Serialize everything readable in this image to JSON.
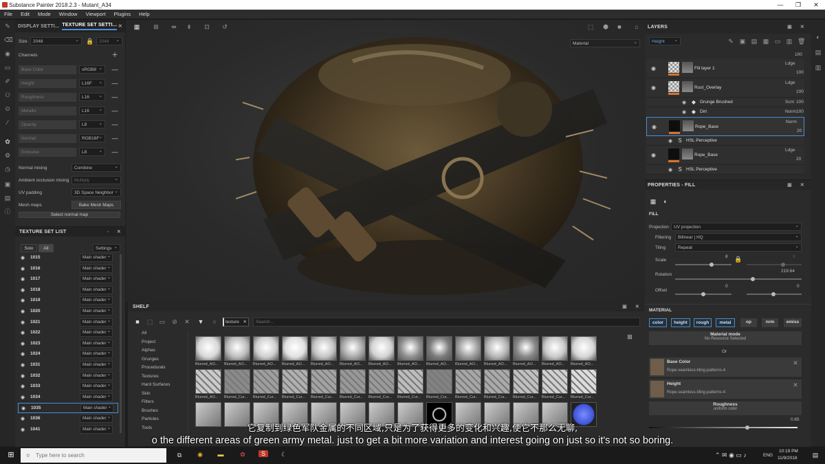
{
  "window": {
    "title": "Substance Painter 2018.2.3 - Mutant_A34",
    "controls": [
      "—",
      "❐",
      "✕"
    ]
  },
  "menu": [
    "File",
    "Edit",
    "Mode",
    "Window",
    "Viewport",
    "Plugins",
    "Help"
  ],
  "left_panel": {
    "tabs": [
      "DISPLAY SETTI...",
      "TEXTURE SET SETTI..."
    ],
    "size_label": "Size",
    "size_value": "2048",
    "size_value2": "2048",
    "channels_label": "Channels",
    "channels": [
      {
        "name": "Base Color",
        "format": "sRGB8"
      },
      {
        "name": "Height",
        "format": "L16F"
      },
      {
        "name": "Roughness",
        "format": "L16"
      },
      {
        "name": "Metallic",
        "format": "L16"
      },
      {
        "name": "Opacity",
        "format": "L8"
      },
      {
        "name": "Normal",
        "format": "RGB16F"
      },
      {
        "name": "Emissive",
        "format": "L8"
      }
    ],
    "normal_mixing_label": "Normal mixing",
    "normal_mixing_value": "Combine",
    "ao_mixing_label": "Ambient occlusion mixing",
    "ao_mixing_value": "Multiply",
    "uv_padding_label": "UV padding",
    "uv_padding_value": "3D Space Neighbor",
    "mesh_maps_label": "Mesh maps",
    "bake_button": "Bake Mesh Maps",
    "select_normal_button": "Select normal map"
  },
  "texture_set_list": {
    "title": "TEXTURE SET LIST",
    "solo": "Solo",
    "all": "All",
    "settings": "Settings",
    "items": [
      {
        "id": "1015",
        "shader": "Main shader"
      },
      {
        "id": "1016",
        "shader": "Main shader"
      },
      {
        "id": "1017",
        "shader": "Main shader"
      },
      {
        "id": "1018",
        "shader": "Main shader"
      },
      {
        "id": "1019",
        "shader": "Main shader"
      },
      {
        "id": "1020",
        "shader": "Main shader"
      },
      {
        "id": "1021",
        "shader": "Main shader"
      },
      {
        "id": "1022",
        "shader": "Main shader"
      },
      {
        "id": "1023",
        "shader": "Main shader"
      },
      {
        "id": "1024",
        "shader": "Main shader"
      },
      {
        "id": "1031",
        "shader": "Main shader"
      },
      {
        "id": "1032",
        "shader": "Main shader"
      },
      {
        "id": "1033",
        "shader": "Main shader"
      },
      {
        "id": "1034",
        "shader": "Main shader"
      },
      {
        "id": "1035",
        "shader": "Main shader"
      },
      {
        "id": "1036",
        "shader": "Main shader"
      },
      {
        "id": "1041",
        "shader": "Main shader"
      }
    ],
    "selected": "1035"
  },
  "viewport": {
    "mode": "Material"
  },
  "shelf": {
    "title": "SHELF",
    "filter": "texture",
    "search_placeholder": "Search...",
    "categories": [
      "All",
      "Project",
      "Alphas",
      "Grunges",
      "Procedurals",
      "Textures",
      "Hard Surfaces",
      "Skin",
      "Filters",
      "Brushes",
      "Particles",
      "Tools"
    ],
    "row1_labels": [
      "Blurred_AO...",
      "Blurred_AO...",
      "Blurred_AO...",
      "Blurred_AO...",
      "Blurred_AO...",
      "Blurred_AO...",
      "Blurred_AO...",
      "Blurred_AO...",
      "Blurred_AO...",
      "Blurred_AO...",
      "Blurred_AO...",
      "Blurred_AO...",
      "Blurred_AO...",
      "Blurred_AO..."
    ],
    "row2_labels": [
      "Blurred_AO...",
      "Blurred_Cur...",
      "Blurred_Cur...",
      "Blurred_Cur...",
      "Blurred_Cur...",
      "Blurred_Cur...",
      "Blurred_Cur...",
      "Blurred_Cur...",
      "Blurred_Cur...",
      "Blurred_Cur...",
      "Blurred_Cur...",
      "Blurred_Cur...",
      "Blurred_Cur...",
      "Blurred_Cur..."
    ]
  },
  "layers": {
    "title": "LAYERS",
    "channel": "Height",
    "items": [
      {
        "name": "Fill layer 1",
        "blend": "Ldge",
        "opacity": "100"
      },
      {
        "name": "Rust_Overlay",
        "blend": "Ldge",
        "opacity": "100"
      },
      {
        "name": "Grunge Brushed",
        "blend": "Scrn",
        "opacity": "100"
      },
      {
        "name": "Dirt",
        "blend": "Norm",
        "opacity": "100"
      },
      {
        "name": "Rope_Base",
        "blend": "Norm",
        "opacity": "20"
      },
      {
        "name": "HSL Perceptive",
        "blend": "",
        "opacity": ""
      },
      {
        "name": "Rope_Base",
        "blend": "Ldge",
        "opacity": "20"
      },
      {
        "name": "HSL Perceptive",
        "blend": "",
        "opacity": ""
      }
    ],
    "top_opacity": "100"
  },
  "properties": {
    "title": "PROPERTIES - FILL",
    "fill_label": "FILL",
    "projection_label": "Projection",
    "projection_value": "UV projection",
    "filtering_label": "Filtering",
    "filtering_value": "Bilinear | HQ",
    "tiling_label": "Tiling",
    "tiling_value": "Repeat",
    "scale_label": "Scale",
    "scale_value": "8",
    "scale_value2": "8",
    "rotation_label": "Rotation",
    "rotation_value": "219.64",
    "offset_label": "Offset",
    "offset_x": "0",
    "offset_y": "0",
    "material_label": "MATERIAL",
    "chips": [
      "color",
      "height",
      "rough",
      "metal",
      "op",
      "nrm",
      "emiss"
    ],
    "material_mode_label": "Material mode",
    "material_mode_value": "No Resource Selected",
    "or_label": "Or",
    "base_color_label": "Base Color",
    "base_color_value": "Rope-seamless-tiling-patterns-4",
    "height_label": "Height",
    "height_value": "Rope-seamless-tiling-patterns-4",
    "roughness_label": "Roughness",
    "roughness_value": "uniform color",
    "roughness_amount": "0.65"
  },
  "subtitles": {
    "cn": "它复制到绿色军队金属的不同区域,只是为了获得更多的变化和兴趣,使它不那么无聊,",
    "en": "o the different areas of green army metal. just to get a bit more variation and interest going on just so it's not so boring."
  },
  "taskbar": {
    "search_placeholder": "Type here to search",
    "lang": "ENG",
    "time": "10:19 PM",
    "date": "11/9/2018"
  },
  "colors": {
    "accent": "#4a90d9",
    "orange": "#d9742a"
  }
}
